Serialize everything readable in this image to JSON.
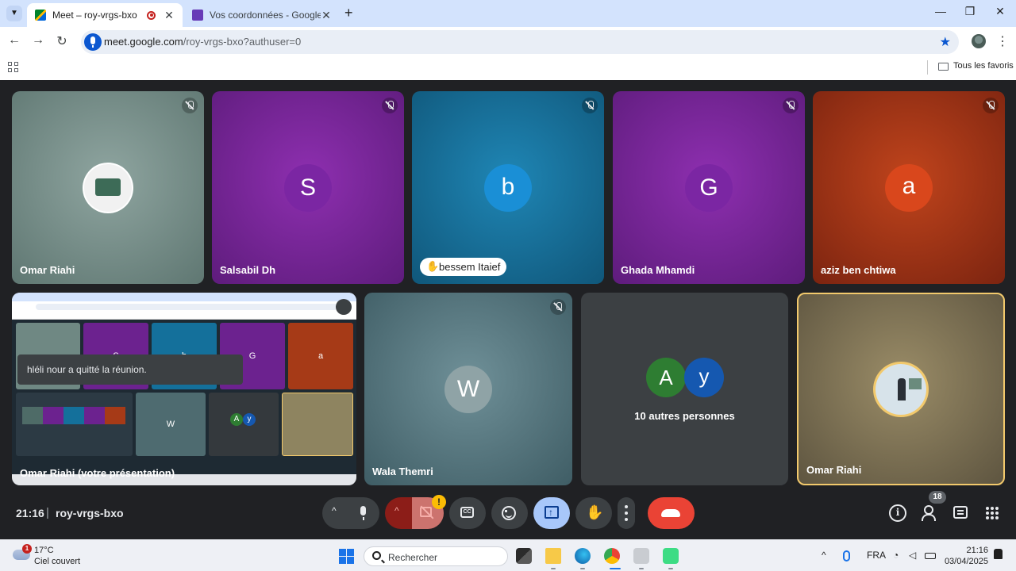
{
  "browser": {
    "tabs": [
      {
        "title": "Meet – roy-vrgs-bxo",
        "active": true
      },
      {
        "title": "Vos coordonnées - Google Form",
        "active": false
      }
    ],
    "url_host": "meet.google.com",
    "url_path": "/roy-vrgs-bxo?authuser=0",
    "bookmarks_label": "Tous les favoris"
  },
  "meeting": {
    "clock": "21:16",
    "separator": "|",
    "code": "roy-vrgs-bxo",
    "toast": "hléli nour a quitté la réunion.",
    "participants_count": "18",
    "camera_warning": "!",
    "tiles": [
      {
        "name": "Omar Riahi",
        "type": "image-avatar",
        "muted": true
      },
      {
        "name": "Salsabil Dh",
        "initial": "S",
        "muted": true
      },
      {
        "name": "bessem Itaief",
        "initial": "b",
        "muted": true,
        "hand_raised": true
      },
      {
        "name": "Ghada Mhamdi",
        "initial": "G",
        "muted": true
      },
      {
        "name": "aziz ben chtiwa",
        "initial": "a",
        "muted": true
      },
      {
        "name": "Omar Riahi (votre présentation)",
        "type": "presentation"
      },
      {
        "name": "Wala Themri",
        "initial": "W",
        "muted": true
      },
      {
        "name": "10 autres personnes",
        "type": "others",
        "initials": [
          "A",
          "y"
        ]
      },
      {
        "name": "Omar Riahi",
        "type": "self",
        "speaking": true
      }
    ],
    "mini_tiles": [
      "S",
      "b",
      "G",
      "a",
      "W",
      "A",
      "y"
    ]
  },
  "taskbar": {
    "temperature": "17°C",
    "condition": "Ciel couvert",
    "weather_badge": "1",
    "search_placeholder": "Rechercher",
    "language": "FRA",
    "time": "21:16",
    "date": "03/04/2025"
  },
  "colors": {
    "tab_strip": "#d3e3fd",
    "stage": "#202124",
    "hangup": "#ea4335",
    "present_active": "#a8c7fa",
    "camera_off": "#8c1d18",
    "active_speaker_border": "#f2c96c"
  }
}
